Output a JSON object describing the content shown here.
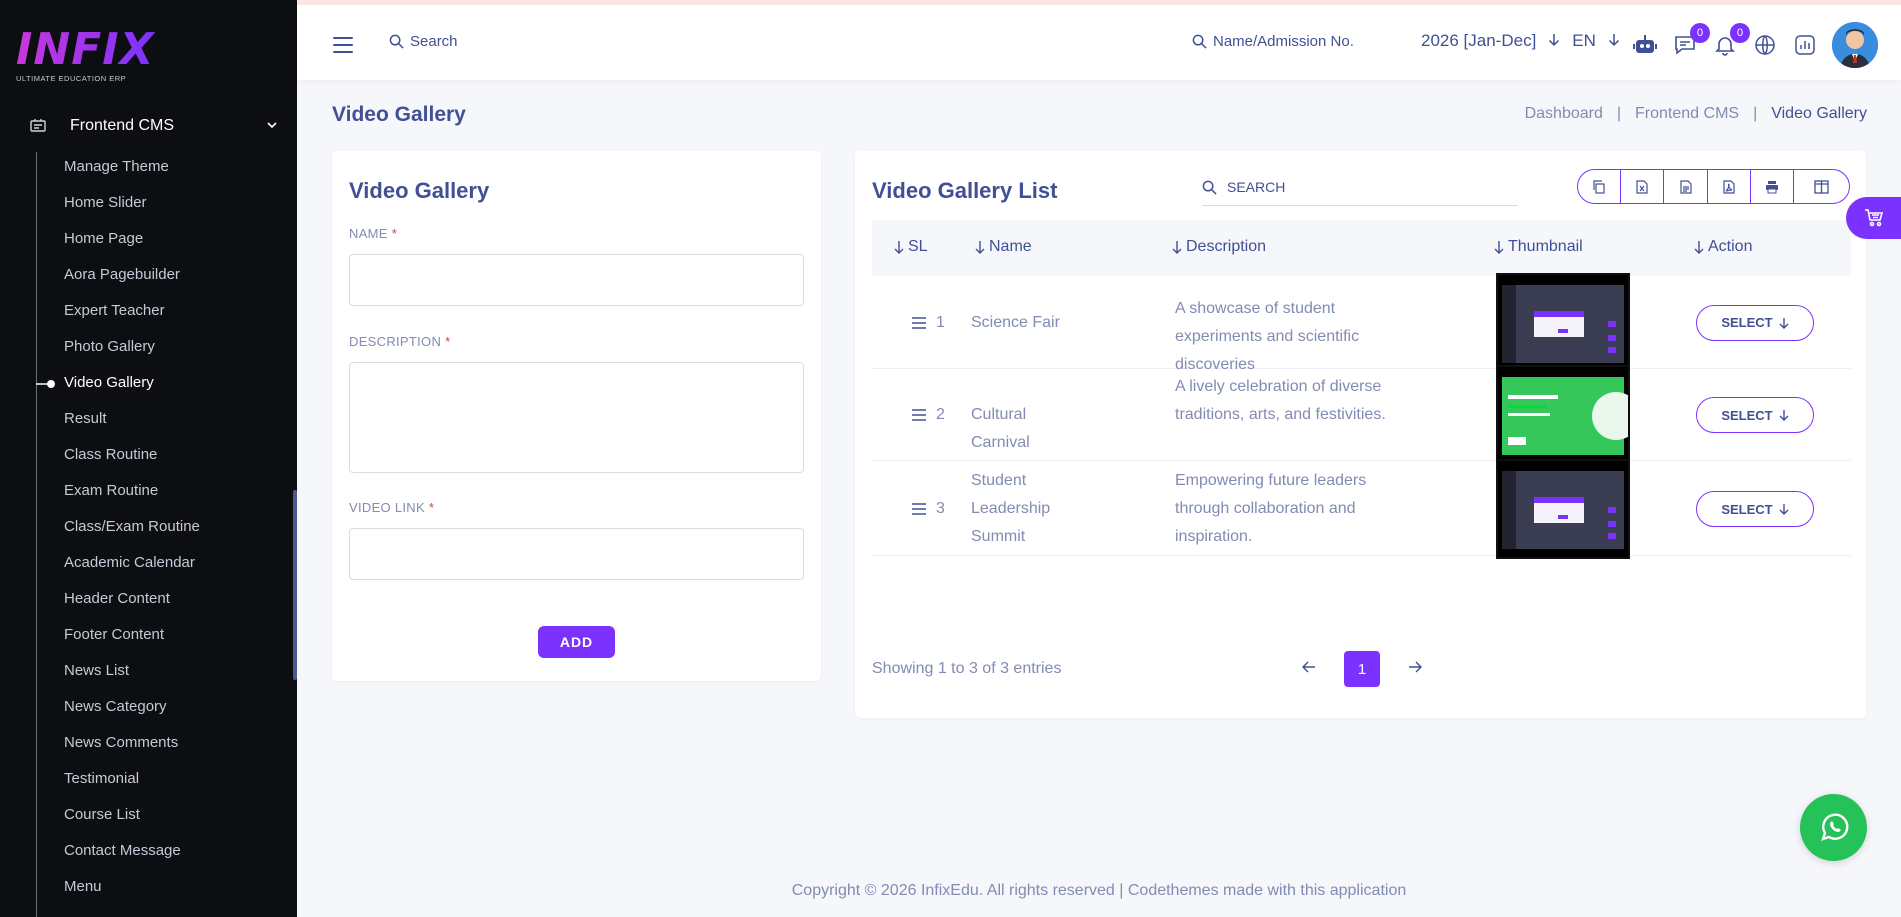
{
  "brand": {
    "logo_text": "INFIX",
    "tagline": "ULTIMATE EDUCATION ERP"
  },
  "sidebar": {
    "section": "Frontend CMS",
    "items": [
      {
        "label": "Manage Theme"
      },
      {
        "label": "Home Slider"
      },
      {
        "label": "Home Page"
      },
      {
        "label": "Aora Pagebuilder"
      },
      {
        "label": "Expert Teacher"
      },
      {
        "label": "Photo Gallery"
      },
      {
        "label": "Video Gallery",
        "active": true
      },
      {
        "label": "Result"
      },
      {
        "label": "Class Routine"
      },
      {
        "label": "Exam Routine"
      },
      {
        "label": "Class/Exam Routine"
      },
      {
        "label": "Academic Calendar"
      },
      {
        "label": "Header Content"
      },
      {
        "label": "Footer Content"
      },
      {
        "label": "News List"
      },
      {
        "label": "News Category"
      },
      {
        "label": "News Comments"
      },
      {
        "label": "Testimonial"
      },
      {
        "label": "Course List"
      },
      {
        "label": "Contact Message"
      },
      {
        "label": "Menu"
      }
    ]
  },
  "header": {
    "search_placeholder": "Search",
    "admission_search": "Name/Admission No.",
    "session": "2026 [Jan-Dec]",
    "language": "EN",
    "chat_count": "0",
    "notification_count": "0"
  },
  "page": {
    "title": "Video Gallery",
    "breadcrumb": [
      "Dashboard",
      "Frontend CMS",
      "Video Gallery"
    ]
  },
  "form": {
    "title": "Video Gallery",
    "name_label": "NAME",
    "description_label": "DESCRIPTION",
    "video_link_label": "VIDEO LINK",
    "required_mark": "*",
    "add_button": "ADD"
  },
  "list": {
    "title": "Video Gallery List",
    "search_placeholder": "SEARCH",
    "columns": [
      "SL",
      "Name",
      "Description",
      "Thumbnail",
      "Action"
    ],
    "rows": [
      {
        "sl": "1",
        "name": "Science Fair",
        "description": "A showcase of student experiments and scientific discoveries",
        "action": "SELECT",
        "thumb": "dark"
      },
      {
        "sl": "2",
        "name": "Cultural Carnival",
        "description": "A lively celebration of diverse traditions, arts, and festivities.",
        "action": "SELECT",
        "thumb": "green"
      },
      {
        "sl": "3",
        "name": "Student Leadership Summit",
        "description": "Empowering future leaders through collaboration and inspiration.",
        "action": "SELECT",
        "thumb": "dark"
      }
    ],
    "showing": "Showing 1 to 3 of 3 entries",
    "current_page": "1"
  },
  "footer": {
    "text": "Copyright © 2026 InfixEdu. All rights reserved | Codethemes made with this application"
  },
  "colors": {
    "accent": "#7c32ff",
    "text": "#415094",
    "muted": "#828bb2",
    "sidebar_bg": "#0d0e12",
    "whatsapp": "#25c25a"
  }
}
